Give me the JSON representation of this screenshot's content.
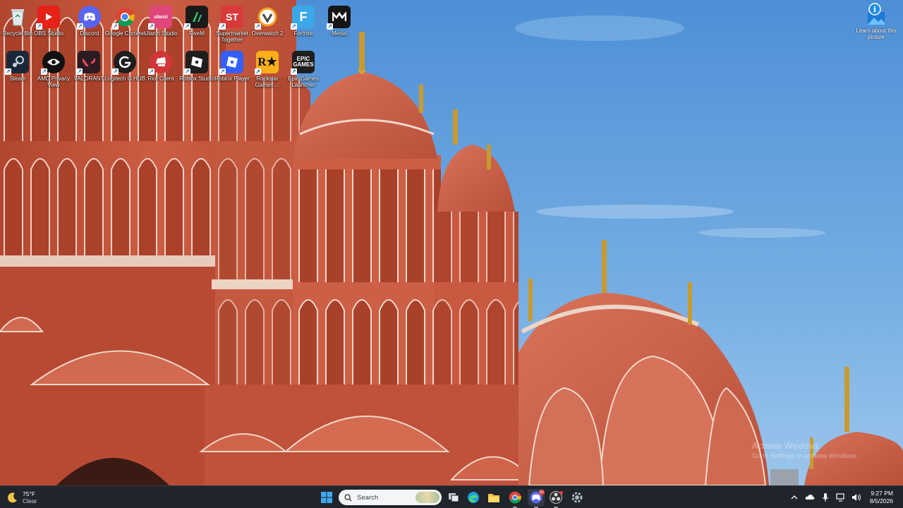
{
  "desktop": {
    "icons": [
      {
        "label": "Recycle Bin",
        "icon": "recycle-bin-icon",
        "color": "#cfd8dc"
      },
      {
        "label": "OBS Studio",
        "icon": "youtube-icon",
        "color": "#e62117"
      },
      {
        "label": "Discord",
        "icon": "discord-icon",
        "color": "#5865f2"
      },
      {
        "label": "Google Chrome",
        "icon": "chrome-icon",
        "color": "#ffffff"
      },
      {
        "label": "Ulanzi Studio",
        "icon": "ulanzi-studio-icon",
        "color": "#e0457b"
      },
      {
        "label": "FiveM",
        "icon": "fivem-icon",
        "color": "#1a1a1a"
      },
      {
        "label": "Supermarket Together",
        "icon": "supermarket-together-icon",
        "color": "#d83a3a"
      },
      {
        "label": "Overwatch 2",
        "icon": "overwatch-icon",
        "color": "#f2f2f2"
      },
      {
        "label": "Fortnite",
        "icon": "fortnite-icon",
        "color": "#3aa8e8"
      },
      {
        "label": "Medal",
        "icon": "medal-icon",
        "color": "#151515"
      },
      {
        "label": "Steam",
        "icon": "steam-icon",
        "color": "#1b2838"
      },
      {
        "label": "AMD Privacy View",
        "icon": "amd-privacy-view-icon",
        "color": "#111111"
      },
      {
        "label": "VALORANT",
        "icon": "valorant-icon",
        "color": "#2b1c24"
      },
      {
        "label": "Logitech G HUB",
        "icon": "logitech-g-hub-icon",
        "color": "#1e1e1e"
      },
      {
        "label": "Riot Client",
        "icon": "riot-client-icon",
        "color": "#d13639"
      },
      {
        "label": "Roblox Studio",
        "icon": "roblox-studio-icon",
        "color": "#1e1e1e"
      },
      {
        "label": "Roblox Player",
        "icon": "roblox-player-icon",
        "color": "#335fff"
      },
      {
        "label": "Rockstar Games ...",
        "icon": "rockstar-games-icon",
        "color": "#fcaf17"
      },
      {
        "label": "Epic Games Launcher",
        "icon": "epic-games-icon",
        "color": "#1f1f1f"
      }
    ],
    "learn": {
      "label": "Learn about this picture",
      "icon": "learn-about-picture-icon"
    },
    "watermark": {
      "line1": "Activate Windows",
      "line2": "Go to Settings to activate Windows."
    }
  },
  "taskbar": {
    "weather": {
      "temp": "75°F",
      "condition": "Clear",
      "icon": "moon-icon"
    },
    "start": {
      "icon": "windows-start-icon"
    },
    "search": {
      "placeholder": "Search",
      "icon": "search-icon"
    },
    "apps": [
      {
        "name": "task-view",
        "icon": "task-view-icon"
      },
      {
        "name": "edge",
        "icon": "edge-icon"
      },
      {
        "name": "file-explorer",
        "icon": "file-explorer-icon"
      },
      {
        "name": "chrome",
        "icon": "chrome-icon"
      },
      {
        "name": "discord",
        "icon": "discord-icon",
        "badge": "9+"
      },
      {
        "name": "obs",
        "icon": "obs-icon"
      },
      {
        "name": "settings",
        "icon": "settings-gear-icon"
      }
    ],
    "tray": {
      "icons": [
        "chevron-up-icon",
        "onedrive-cloud-icon",
        "microphone-icon",
        "network-icon",
        "volume-icon"
      ],
      "time": "9:27 PM",
      "date": "8/5/2026"
    }
  },
  "colors": {
    "sky": "#5f9ed9",
    "palace": "#c8553d",
    "taskbar": "#20242b"
  }
}
